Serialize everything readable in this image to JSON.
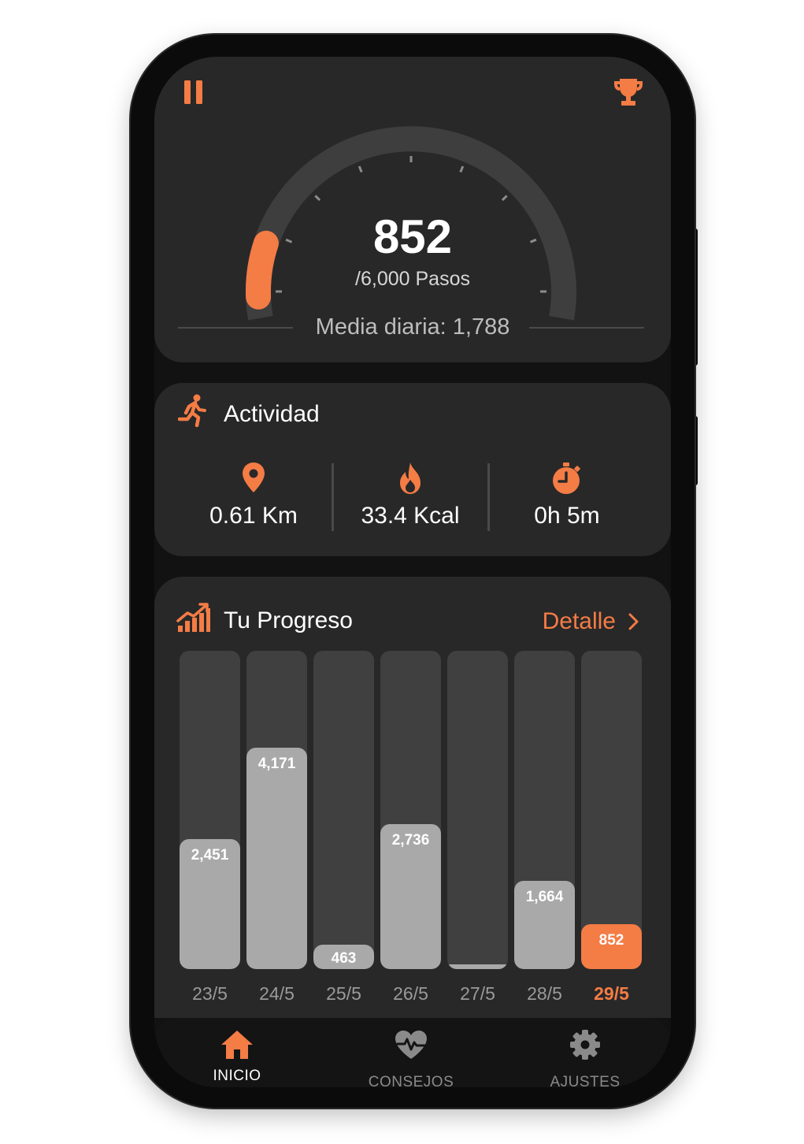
{
  "colors": {
    "accent": "#f47c45",
    "card": "#282828",
    "background": "#121212",
    "bar_inactive": "#a9a9a9",
    "track": "#404040"
  },
  "header": {
    "left_icon": "pause-icon",
    "right_icon": "trophy-icon"
  },
  "gauge": {
    "current": 852,
    "goal": 6000,
    "value_text": "852",
    "goal_text": "/6,000 Pasos",
    "daily_average_text": "Media diaria: 1,788"
  },
  "activity": {
    "title": "Actividad",
    "icon": "running-person-icon",
    "metrics": [
      {
        "icon": "location-pin-icon",
        "value": "0.61 Km"
      },
      {
        "icon": "flame-icon",
        "value": "33.4 Kcal"
      },
      {
        "icon": "stopwatch-icon",
        "value": "0h 5m"
      }
    ]
  },
  "progress": {
    "title": "Tu Progreso",
    "icon": "trending-chart-icon",
    "detail_label": "Detalle",
    "detail_icon": "chevron-right-icon"
  },
  "chart_data": {
    "type": "bar",
    "categories": [
      "23/5",
      "24/5",
      "25/5",
      "26/5",
      "27/5",
      "28/5",
      "29/5"
    ],
    "values": [
      2451,
      4171,
      463,
      2736,
      0,
      1664,
      852
    ],
    "value_labels": [
      "2,451",
      "4,171",
      "463",
      "2,736",
      "",
      "1,664",
      "852"
    ],
    "ylim": [
      0,
      6000
    ],
    "highlighted_index": 6
  },
  "nav": [
    {
      "label": "INICIO",
      "icon": "home-icon",
      "active": true
    },
    {
      "label": "CONSEJOS",
      "icon": "heart-pulse-icon",
      "active": false
    },
    {
      "label": "AJUSTES",
      "icon": "gear-icon",
      "active": false
    }
  ]
}
